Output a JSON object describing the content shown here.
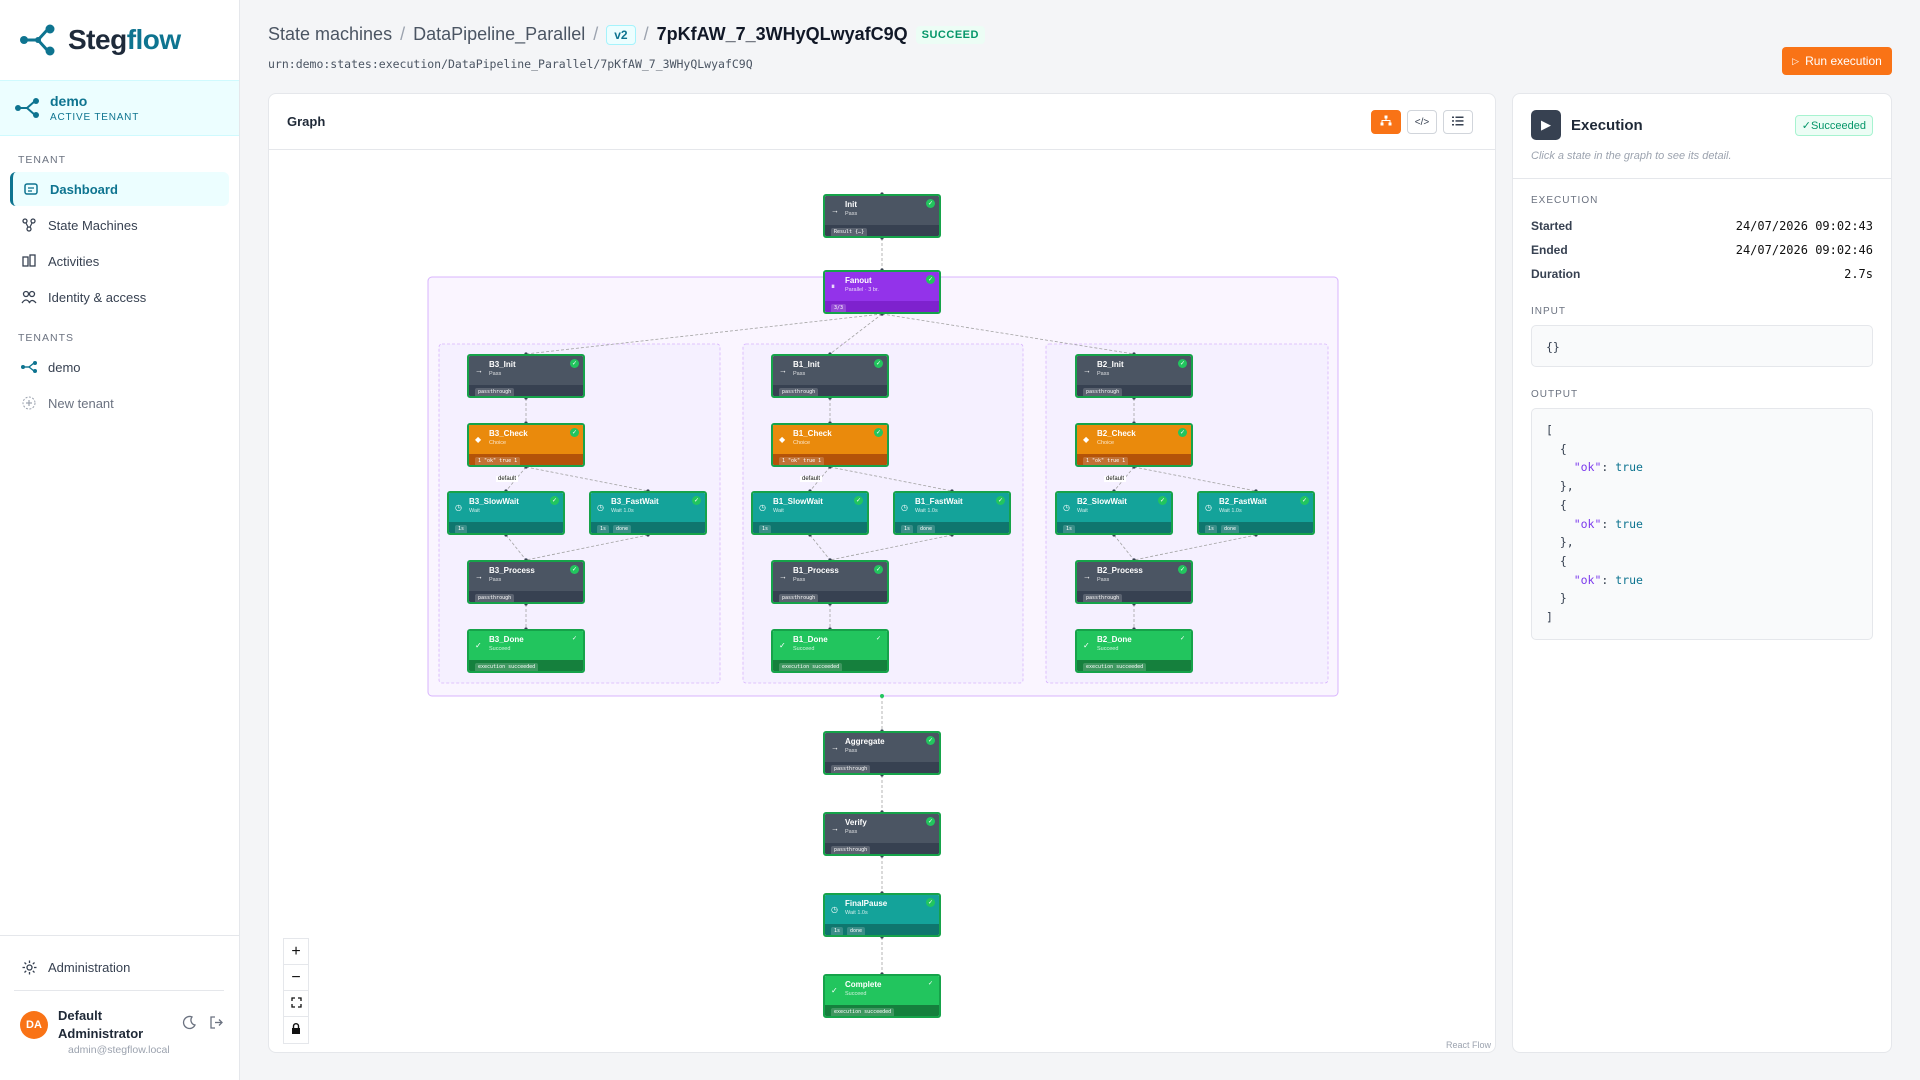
{
  "brand": {
    "name_main": "Steg",
    "name_accent": "flow"
  },
  "tenant_card": {
    "name": "demo",
    "subtitle": "ACTIVE TENANT"
  },
  "sidebar": {
    "section_tenant": "TENANT",
    "nav": [
      {
        "label": "Dashboard",
        "icon": "dashboard-icon",
        "active": true
      },
      {
        "label": "State Machines",
        "icon": "state-machines-icon"
      },
      {
        "label": "Activities",
        "icon": "activities-icon"
      },
      {
        "label": "Identity & access",
        "icon": "users-icon"
      }
    ],
    "section_tenants": "TENANTS",
    "tenants": [
      {
        "label": "demo"
      }
    ],
    "new_tenant": "New tenant",
    "administration": "Administration"
  },
  "user": {
    "initials": "DA",
    "name": "Default Administrator",
    "email": "admin@stegflow.local"
  },
  "header": {
    "crumb_1": "State machines",
    "crumb_2": "DataPipeline_Parallel",
    "version": "v2",
    "execution_id": "7pKfAW_7_3WHyQLwyafC9Q",
    "status": "SUCCEED",
    "urn": "urn:demo:states:execution/DataPipeline_Parallel/7pKfAW_7_3WHyQLwyafC9Q",
    "run_button": "Run execution"
  },
  "graph": {
    "title": "Graph",
    "attribution": "React Flow",
    "edge_label_default": "default",
    "nodes": {
      "init": {
        "name": "Init",
        "type": "Pass",
        "foot": [
          "Result {…}"
        ]
      },
      "fanout": {
        "name": "Fanout",
        "type": "Parallel · 3 br.",
        "foot": [
          "3/3"
        ]
      },
      "b3_init": {
        "name": "B3_Init",
        "type": "Pass",
        "foot": [
          "passthrough"
        ]
      },
      "b3_check": {
        "name": "B3_Check",
        "type": "Choice",
        "foot": [
          "1 \"ok\" true 1"
        ]
      },
      "b3_slow": {
        "name": "B3_SlowWait",
        "type": "Wait",
        "foot": [
          "1s"
        ]
      },
      "b3_fast": {
        "name": "B3_FastWait",
        "type": "Wait 1.0s",
        "foot": [
          "1s",
          "done"
        ]
      },
      "b3_process": {
        "name": "B3_Process",
        "type": "Pass",
        "foot": [
          "passthrough"
        ]
      },
      "b3_done": {
        "name": "B3_Done",
        "type": "Succeed",
        "foot": [
          "execution succeeded"
        ]
      },
      "b1_init": {
        "name": "B1_Init",
        "type": "Pass",
        "foot": [
          "passthrough"
        ]
      },
      "b1_check": {
        "name": "B1_Check",
        "type": "Choice",
        "foot": [
          "1 \"ok\" true 1"
        ]
      },
      "b1_slow": {
        "name": "B1_SlowWait",
        "type": "Wait",
        "foot": [
          "1s"
        ]
      },
      "b1_fast": {
        "name": "B1_FastWait",
        "type": "Wait 1.0s",
        "foot": [
          "1s",
          "done"
        ]
      },
      "b1_process": {
        "name": "B1_Process",
        "type": "Pass",
        "foot": [
          "passthrough"
        ]
      },
      "b1_done": {
        "name": "B1_Done",
        "type": "Succeed",
        "foot": [
          "execution succeeded"
        ]
      },
      "b2_init": {
        "name": "B2_Init",
        "type": "Pass",
        "foot": [
          "passthrough"
        ]
      },
      "b2_check": {
        "name": "B2_Check",
        "type": "Choice",
        "foot": [
          "1 \"ok\" true 1"
        ]
      },
      "b2_slow": {
        "name": "B2_SlowWait",
        "type": "Wait",
        "foot": [
          "1s"
        ]
      },
      "b2_fast": {
        "name": "B2_FastWait",
        "type": "Wait 1.0s",
        "foot": [
          "1s",
          "done"
        ]
      },
      "b2_process": {
        "name": "B2_Process",
        "type": "Pass",
        "foot": [
          "passthrough"
        ]
      },
      "b2_done": {
        "name": "B2_Done",
        "type": "Succeed",
        "foot": [
          "execution succeeded"
        ]
      },
      "aggregate": {
        "name": "Aggregate",
        "type": "Pass",
        "foot": [
          "passthrough"
        ]
      },
      "verify": {
        "name": "Verify",
        "type": "Pass",
        "foot": [
          "passthrough"
        ]
      },
      "finalpause": {
        "name": "FinalPause",
        "type": "Wait 1.0s",
        "foot": [
          "1s",
          "done"
        ]
      },
      "complete": {
        "name": "Complete",
        "type": "Succeed",
        "foot": [
          "execution succeeded"
        ]
      }
    }
  },
  "panel": {
    "title": "Execution",
    "badge": "Succeeded",
    "hint": "Click a state in the graph to see its detail.",
    "section_execution": "EXECUTION",
    "started_label": "Started",
    "started_value": "24/07/2026 09:02:43",
    "ended_label": "Ended",
    "ended_value": "24/07/2026 09:02:46",
    "duration_label": "Duration",
    "duration_value": "2.7s",
    "section_input": "INPUT",
    "input_value": "{}",
    "section_output": "OUTPUT",
    "output_key": "\"ok\"",
    "output_val": "true"
  },
  "colors": {
    "accent": "#f97316",
    "brand": "#0e7490",
    "success": "#22c55e"
  }
}
